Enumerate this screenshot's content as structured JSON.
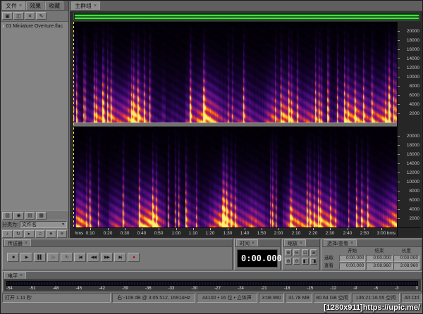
{
  "left_panel": {
    "tabs": [
      {
        "label": "文件",
        "close": "×",
        "active": true
      },
      {
        "label": "效果",
        "active": false
      },
      {
        "label": "收藏",
        "active": false
      }
    ],
    "toolbar_icons": [
      {
        "name": "import-file-icon",
        "glyph": "▣"
      },
      {
        "name": "import-folder-icon",
        "glyph": "◫"
      },
      {
        "name": "close-file-icon",
        "glyph": "✕"
      },
      {
        "name": "edit-file-icon",
        "glyph": "✎"
      }
    ],
    "files": [
      {
        "icon": "audio-file-icon",
        "icon_glyph": "♪",
        "name": "01 Miniature Overture.flac"
      }
    ],
    "bottom_icons": [
      {
        "name": "insert-into-multitrack-icon",
        "glyph": "▥"
      },
      {
        "name": "insert-into-cd-list-icon",
        "glyph": "◉"
      },
      {
        "name": "open-file-icon",
        "glyph": "▤"
      },
      {
        "name": "advanced-options-icon",
        "glyph": "▦"
      }
    ],
    "sort": {
      "label": "分类为:",
      "value": "文件名",
      "dropdown_glyph": "▼"
    },
    "filter_toggles": [
      {
        "name": "show-audio-files-toggle",
        "glyph": "♪"
      },
      {
        "name": "show-loop-files-toggle",
        "glyph": "↻"
      },
      {
        "name": "show-video-files-toggle",
        "glyph": "▸"
      },
      {
        "name": "show-midi-files-toggle",
        "glyph": "♫"
      },
      {
        "name": "show-markers-toggle",
        "glyph": "▾"
      },
      {
        "name": "show-full-paths-toggle",
        "glyph": "≡"
      }
    ]
  },
  "main": {
    "tab": {
      "label": "主群组",
      "close": "×"
    },
    "timeline": {
      "unit_label": "hms",
      "ticks": [
        "0:10",
        "0:20",
        "0:30",
        "0:40",
        "0:50",
        "1:00",
        "1:10",
        "1:20",
        "1:30",
        "1:40",
        "1:50",
        "2:00",
        "2:10",
        "2:20",
        "2:30",
        "2:40",
        "2:50",
        "3:00"
      ]
    },
    "freq_ruler": {
      "labels": [
        20000,
        18000,
        16000,
        14000,
        12000,
        10000,
        8000,
        6000,
        4000,
        2000
      ]
    }
  },
  "panels": {
    "transport": {
      "title": "传送器",
      "close": "×",
      "buttons": [
        {
          "name": "stop-button",
          "glyph": "■"
        },
        {
          "name": "play-button",
          "glyph": "▶"
        },
        {
          "name": "pause-button",
          "glyph": "▌▌"
        },
        {
          "name": "play-from-cursor-button",
          "glyph": "▷"
        },
        {
          "name": "play-looped-button",
          "glyph": "↻"
        },
        {
          "name": "go-to-beginning-button",
          "glyph": "|◀"
        },
        {
          "name": "rewind-button",
          "glyph": "◀◀"
        },
        {
          "name": "fast-forward-button",
          "glyph": "▶▶"
        },
        {
          "name": "go-to-end-button",
          "glyph": "▶|"
        },
        {
          "name": "record-button",
          "glyph": "●",
          "color": "#b00000"
        }
      ]
    },
    "time": {
      "title": "时间",
      "close": "×",
      "value": "0:00.000"
    },
    "zoom": {
      "title": "缩放",
      "close": "×",
      "rows": [
        [
          {
            "name": "zoom-in-horizontal-button",
            "glyph": "⊕"
          },
          {
            "name": "zoom-out-horizontal-button",
            "glyph": "⊖"
          },
          {
            "name": "zoom-full-button",
            "glyph": "⊡"
          },
          {
            "name": "zoom-to-selection-button",
            "glyph": "⊞"
          }
        ],
        [
          {
            "name": "zoom-in-vertical-button",
            "glyph": "⊕"
          },
          {
            "name": "zoom-out-vertical-button",
            "glyph": "⊖"
          },
          {
            "name": "zoom-selection-left-button",
            "glyph": "◧"
          },
          {
            "name": "zoom-selection-right-button",
            "glyph": "◨"
          }
        ]
      ]
    },
    "selview": {
      "title": "选择/查看",
      "close": "×",
      "col_headers": [
        "开始",
        "结束",
        "长度"
      ],
      "rows": [
        {
          "label": "选取",
          "values": [
            "0:00.000",
            "0:00.000",
            "0:00.000"
          ]
        },
        {
          "label": "查看",
          "values": [
            "0:00.000",
            "3:08.960",
            "3:08.960"
          ]
        }
      ]
    },
    "levels": {
      "title": "电平",
      "close": "×",
      "scale": [
        -54,
        -51,
        -48,
        -45,
        -42,
        -39,
        -36,
        -33,
        -30,
        -27,
        -24,
        -21,
        -18,
        -15,
        -12,
        -9,
        -6,
        -3,
        0
      ]
    }
  },
  "status_bar": {
    "fields": [
      {
        "name": "hint",
        "text": "打开 1.11 秒"
      },
      {
        "name": "cursor-info",
        "text": "右:-108 dB @ 3:05.512, 16914Hz"
      },
      {
        "name": "sample-format",
        "text": "44100 • 16 位 • 立体声"
      },
      {
        "name": "duration",
        "text": "3:08.960"
      },
      {
        "name": "file-size",
        "text": "31.78 MB"
      },
      {
        "name": "disk-free",
        "text": "80.64 GB 空闲"
      },
      {
        "name": "time-free",
        "text": "136:21:16.55 空闲"
      },
      {
        "name": "modifier-keys",
        "text": "Alt Ctrl"
      }
    ]
  },
  "watermark": "[1280x911]https://upic.me/",
  "colors": {
    "overview_green": "#42e042",
    "playhead": "#ffe14a",
    "spectro_stops": [
      [
        "0.00",
        "#000000"
      ],
      [
        "0.18",
        "#190437"
      ],
      [
        "0.35",
        "#3f0a70"
      ],
      [
        "0.50",
        "#6e1384"
      ],
      [
        "0.62",
        "#a81e6b"
      ],
      [
        "0.74",
        "#e03d26"
      ],
      [
        "0.86",
        "#ff9608"
      ],
      [
        "1.00",
        "#ffef75"
      ]
    ]
  }
}
